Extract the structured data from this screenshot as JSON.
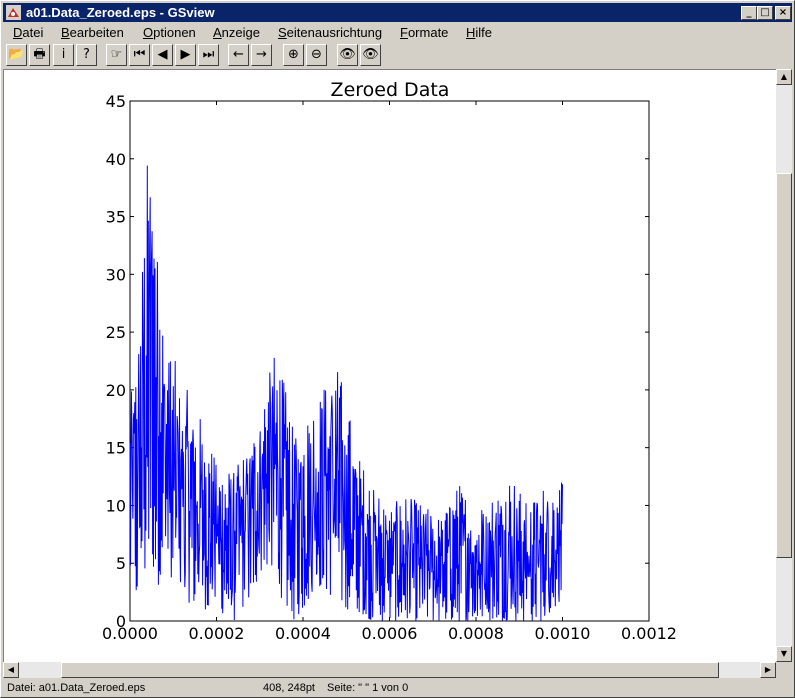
{
  "window": {
    "title": "a01.Data_Zeroed.eps - GSview",
    "minimize_glyph": "_",
    "maximize_glyph": "□",
    "close_glyph": "×"
  },
  "menu": [
    {
      "name": "datei",
      "label": "Datei",
      "u": "D",
      "rest": "atei"
    },
    {
      "name": "bearbeiten",
      "label": "Bearbeiten",
      "u": "B",
      "rest": "earbeiten"
    },
    {
      "name": "optionen",
      "label": "Optionen",
      "u": "O",
      "rest": "ptionen"
    },
    {
      "name": "anzeige",
      "label": "Anzeige",
      "u": "A",
      "rest": "nzeige"
    },
    {
      "name": "seitenausrichtung",
      "label": "Seitenausrichtung",
      "u": "S",
      "rest": "eitenausrichtung"
    },
    {
      "name": "formate",
      "label": "Formate",
      "u": "F",
      "rest": "ormate"
    },
    {
      "name": "hilfe",
      "label": "Hilfe",
      "u": "H",
      "rest": "ilfe"
    }
  ],
  "toolbar": [
    {
      "name": "open-icon",
      "glyph": "📂"
    },
    {
      "name": "print-icon",
      "glyph": "🖶"
    },
    {
      "name": "info-icon",
      "glyph": "i"
    },
    {
      "name": "help-icon",
      "glyph": "?"
    },
    {
      "name": "goto-page-icon",
      "glyph": "☞"
    },
    {
      "name": "first-page-icon",
      "glyph": "⏮"
    },
    {
      "name": "prev-page-icon",
      "glyph": "◀"
    },
    {
      "name": "next-page-icon",
      "glyph": "▶"
    },
    {
      "name": "last-page-icon",
      "glyph": "⏭"
    },
    {
      "name": "back-icon",
      "glyph": "←"
    },
    {
      "name": "forward-icon",
      "glyph": "→"
    },
    {
      "name": "zoom-in-icon",
      "glyph": "⊕"
    },
    {
      "name": "zoom-out-icon",
      "glyph": "⊖"
    },
    {
      "name": "find-text-icon",
      "glyph": "👁"
    },
    {
      "name": "find-next-icon",
      "glyph": "👁"
    }
  ],
  "status": {
    "file": "Datei: a01.Data_Zeroed.eps",
    "coords": "408, 248pt",
    "page": "Seite: \" \"  1 von 0"
  },
  "colors": {
    "title_bg": "#0a246a",
    "series": "#0000ff"
  },
  "chart_data": {
    "type": "line",
    "title": "Zeroed Data",
    "xlabel": "",
    "ylabel": "",
    "xlim": [
      0,
      0.0012
    ],
    "ylim": [
      0,
      45
    ],
    "xticks": [
      "0.0000",
      "0.0002",
      "0.0004",
      "0.0006",
      "0.0008",
      "0.0010",
      "0.0012"
    ],
    "yticks": [
      "0",
      "5",
      "10",
      "15",
      "20",
      "25",
      "30",
      "35",
      "40",
      "45"
    ],
    "x_start": 0,
    "x_end": 0.001,
    "envelope": [
      [
        0.0,
        3,
        19
      ],
      [
        2e-05,
        1,
        25
      ],
      [
        4e-05,
        4,
        40
      ],
      [
        5e-05,
        6,
        41
      ],
      [
        6e-05,
        2,
        36
      ],
      [
        8e-05,
        6,
        25
      ],
      [
        0.0001,
        1,
        23
      ],
      [
        0.00012,
        2,
        21
      ],
      [
        0.00016,
        1,
        18
      ],
      [
        0.0002,
        1,
        14
      ],
      [
        0.00024,
        0,
        13
      ],
      [
        0.00028,
        2,
        16
      ],
      [
        0.00031,
        5,
        20
      ],
      [
        0.00034,
        3,
        24
      ],
      [
        0.00036,
        1,
        20
      ],
      [
        0.00038,
        0,
        16
      ],
      [
        0.0004,
        1,
        18
      ],
      [
        0.00044,
        3,
        20
      ],
      [
        0.00047,
        2,
        23
      ],
      [
        0.0005,
        1,
        20
      ],
      [
        0.00052,
        1,
        15
      ],
      [
        0.00056,
        0,
        12
      ],
      [
        0.0006,
        0,
        10
      ],
      [
        0.00064,
        0,
        11
      ],
      [
        0.00068,
        0,
        10
      ],
      [
        0.00072,
        0,
        9
      ],
      [
        0.00076,
        0,
        12
      ],
      [
        0.0008,
        0,
        10
      ],
      [
        0.00084,
        0,
        11
      ],
      [
        0.00088,
        0,
        13
      ],
      [
        0.00092,
        0,
        10
      ],
      [
        0.00096,
        0,
        12
      ],
      [
        0.001,
        2,
        12
      ]
    ]
  }
}
